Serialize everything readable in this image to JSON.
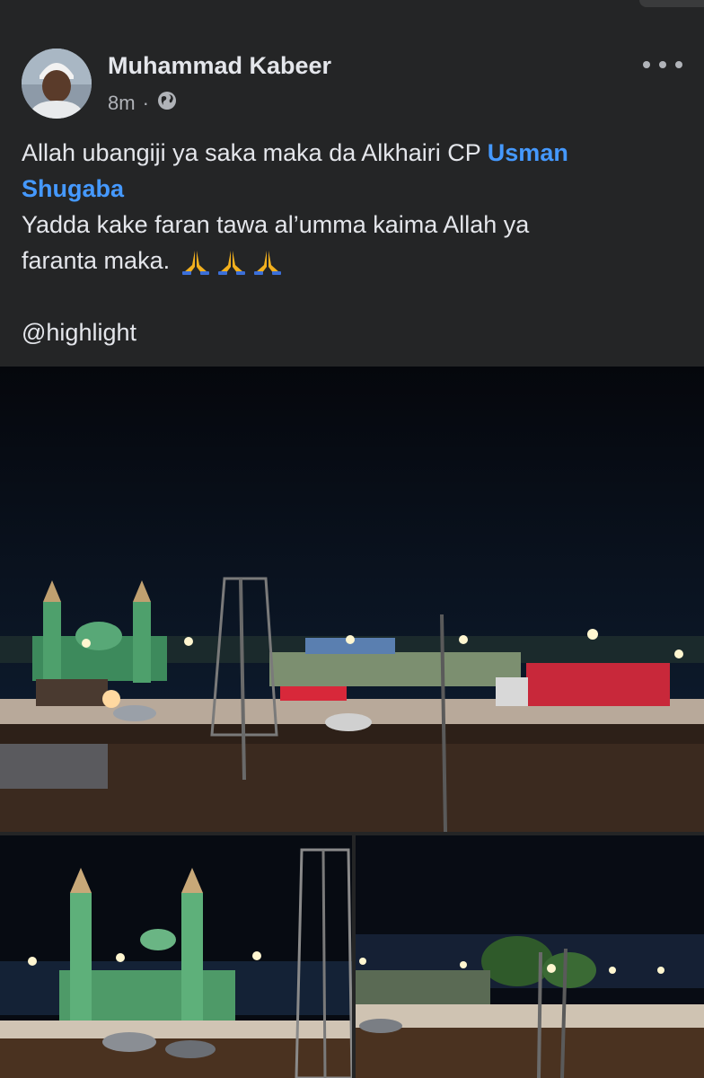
{
  "post": {
    "author_name": "Muhammad Kabeer",
    "timestamp": "8m",
    "separator": "·",
    "audience_icon": "globe-icon",
    "more_icon": "more-options-icon",
    "text": {
      "line1_prefix": "Allah ubangiji ya saka maka da Alkhairi CP ",
      "mention_part1": "Usman",
      "mention_part2": "Shugaba",
      "line3": "Yadda kake faran tawa al’umma kaima Allah ya",
      "line4": "faranta maka.",
      "emoji_icons": [
        "folded-hands-icon",
        "folded-hands-icon",
        "folded-hands-icon"
      ],
      "tag": "@highlight"
    },
    "photos": [
      {
        "description_icon": "night-road-mosque-photo"
      },
      {
        "description_icon": "mosque-minarets-photo"
      },
      {
        "description_icon": "street-lights-photo"
      }
    ]
  },
  "colors": {
    "background": "#242526",
    "text": "#e4e6eb",
    "secondary_text": "#b0b3b8",
    "mention": "#4599ff"
  }
}
